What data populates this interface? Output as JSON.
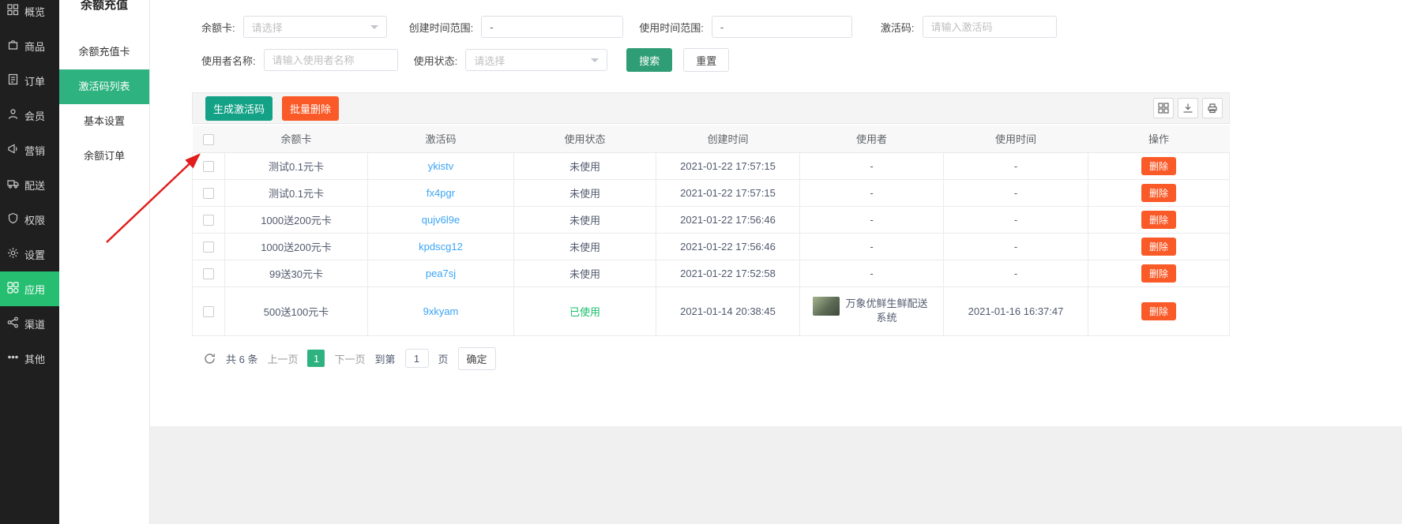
{
  "sidebar": {
    "items": [
      {
        "label": "概览",
        "icon": "overview-icon"
      },
      {
        "label": "商品",
        "icon": "goods-icon"
      },
      {
        "label": "订单",
        "icon": "orders-icon"
      },
      {
        "label": "会员",
        "icon": "members-icon"
      },
      {
        "label": "营销",
        "icon": "marketing-icon"
      },
      {
        "label": "配送",
        "icon": "delivery-icon"
      },
      {
        "label": "权限",
        "icon": "permissions-icon"
      },
      {
        "label": "设置",
        "icon": "settings-icon"
      },
      {
        "label": "应用",
        "icon": "apps-icon",
        "active": true
      },
      {
        "label": "渠道",
        "icon": "channels-icon"
      },
      {
        "label": "其他",
        "icon": "other-icon"
      }
    ]
  },
  "submenu": {
    "title": "余额充值",
    "items": [
      {
        "label": "余额充值卡"
      },
      {
        "label": "激活码列表",
        "active": true
      },
      {
        "label": "基本设置"
      },
      {
        "label": "余额订单"
      }
    ]
  },
  "filters": {
    "balance_card_label": "余额卡:",
    "balance_card_placeholder": "请选择",
    "create_time_label": "创建时间范围:",
    "create_time_value": "-",
    "use_time_label": "使用时间范围:",
    "use_time_value": "-",
    "code_label": "激活码:",
    "code_placeholder": "请输入激活码",
    "user_name_label": "使用者名称:",
    "user_name_placeholder": "请输入使用者名称",
    "use_status_label": "使用状态:",
    "use_status_placeholder": "请选择",
    "search_label": "搜索",
    "reset_label": "重置"
  },
  "toolbar": {
    "generate_label": "生成激活码",
    "batch_delete_label": "批量删除",
    "icons": [
      "grid-view-icon",
      "export-icon",
      "print-icon"
    ]
  },
  "table": {
    "columns": [
      "余额卡",
      "激活码",
      "使用状态",
      "创建时间",
      "使用者",
      "使用时间",
      "操作"
    ],
    "delete_label": "删除",
    "rows": [
      {
        "card": "测试0.1元卡",
        "code": "ykistv",
        "status": "未使用",
        "created": "2021-01-22 17:57:15",
        "user": "-",
        "used_at": "-"
      },
      {
        "card": "测试0.1元卡",
        "code": "fx4pgr",
        "status": "未使用",
        "created": "2021-01-22 17:57:15",
        "user": "-",
        "used_at": "-"
      },
      {
        "card": "1000送200元卡",
        "code": "qujv6l9e",
        "status": "未使用",
        "created": "2021-01-22 17:56:46",
        "user": "-",
        "used_at": "-"
      },
      {
        "card": "1000送200元卡",
        "code": "kpdscg12",
        "status": "未使用",
        "created": "2021-01-22 17:56:46",
        "user": "-",
        "used_at": "-"
      },
      {
        "card": "99送30元卡",
        "code": "pea7sj",
        "status": "未使用",
        "created": "2021-01-22 17:52:58",
        "user": "-",
        "used_at": "-"
      },
      {
        "card": "500送100元卡",
        "code": "9xkyam",
        "status": "已使用",
        "created": "2021-01-14 20:38:45",
        "user": "万象优鲜生鲜配送系统",
        "used_at": "2021-01-16 16:37:47"
      }
    ]
  },
  "pagination": {
    "total_text": "共 6 条",
    "prev_label": "上一页",
    "current_page": "1",
    "next_label": "下一页",
    "goto_prefix": "到第",
    "goto_value": "1",
    "goto_suffix": "页",
    "confirm_label": "确定"
  },
  "colors": {
    "sidebar_active_green": "#26bf71",
    "submenu_active_green": "#2eb380",
    "search_button_green": "#2f9e76",
    "generate_button_teal": "#13a286",
    "danger_orange": "#fa5a28",
    "link_blue": "#3aa4f6",
    "status_used_green": "#19be6b",
    "annotation_arrow_red": "#e11d1d"
  }
}
